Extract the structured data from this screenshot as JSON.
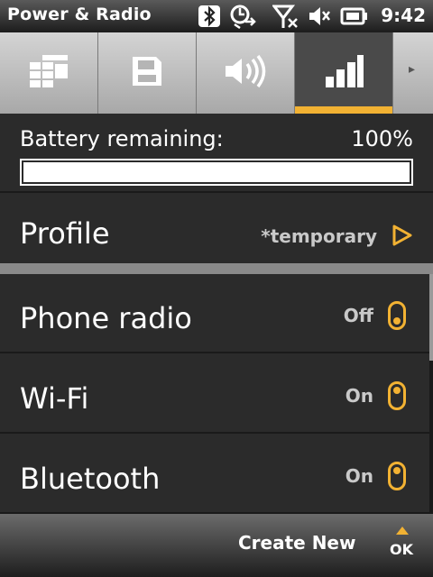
{
  "status_bar": {
    "title": "Power & Radio",
    "time": "9:42",
    "icons": [
      "bluetooth-icon",
      "connection-sync-icon",
      "signal-off-icon",
      "speaker-muted-icon",
      "battery-charging-icon"
    ]
  },
  "tabs": {
    "items": [
      {
        "icon": "list-icon"
      },
      {
        "icon": "memory-card-icon"
      },
      {
        "icon": "speaker-icon"
      },
      {
        "icon": "signal-bars-icon",
        "active": true
      }
    ],
    "scroll_label": "▸"
  },
  "battery": {
    "label": "Battery remaining:",
    "value": "100%",
    "level_percent": 100
  },
  "profile": {
    "label": "Profile",
    "value": "*temporary"
  },
  "radios": [
    {
      "label": "Phone radio",
      "state": "Off"
    },
    {
      "label": "Wi-Fi",
      "state": "On"
    },
    {
      "label": "Bluetooth",
      "state": "On"
    }
  ],
  "softkeys": {
    "left": "Create New",
    "right": "OK"
  },
  "colors": {
    "accent": "#f2b233",
    "background": "#2b2b2b"
  }
}
